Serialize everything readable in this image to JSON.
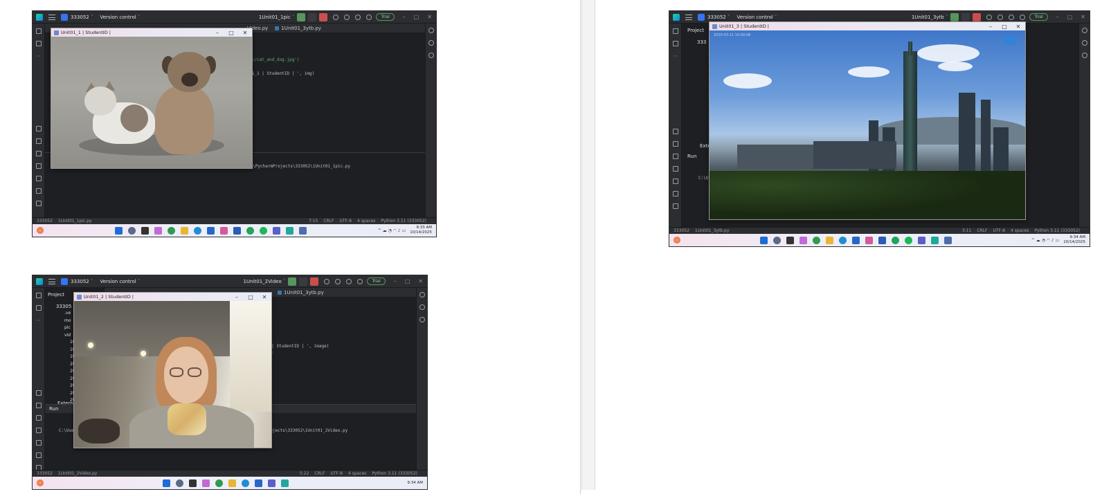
{
  "colors": {
    "accent_green": "#57965c",
    "accent_red": "#c94f4f",
    "ide_bg": "#1e1f22",
    "ide_panel": "#2b2d30"
  },
  "shot1": {
    "project": "333052",
    "version_control": "Version control",
    "run_config": "1Unit01_1pic",
    "trial": "Trial",
    "tabs": [
      "Video.py",
      "1Unit01_3ytb.py"
    ],
    "code_lines": [
      "'pic/cat_and_dog.jpg')",
      "()",
      "it01_1 | StudentID | ', img)"
    ],
    "run_cmd": "C:\\Users\\hanna\\PycharmProjects\\333052\\.venv\\Scripts\\python.exe C:\\Users\\hanna\\PycharmProjects\\333052\\1Unit01_1pic.py",
    "status_path": [
      "333052",
      "1Unit01_1pic.py"
    ],
    "status_right": [
      "7:15",
      "CRLF",
      "UTF-8",
      "4 spaces",
      "Python 3.11 (333052)"
    ],
    "popup_title": "Unit01_1 | StudentID |",
    "time": "9:33 AM",
    "date": "10/14/2025"
  },
  "shot2": {
    "project": "333052",
    "version_control": "Version control",
    "run_config": "1Unit01_3ytb",
    "trial": "Trial",
    "project_label": "Project",
    "tree_root": "333",
    "tree_external": "Exte",
    "run_label": "Run",
    "run_cmd": "C:\\U",
    "status_path": [
      "333052",
      "1Unit01_3ytb.py"
    ],
    "status_right": [
      "3:11",
      "CRLF",
      "UTF-8",
      "4 spaces",
      "Python 3.11 (333052)"
    ],
    "popup_title": "Unit01_3 | StudentID |",
    "photo_tag": "2020-03-11 10:09:08",
    "time": "9:34 AM",
    "date": "10/14/2025"
  },
  "shot3": {
    "project": "333052",
    "version_control": "Version control",
    "run_config": "1Unit01_2Video",
    "trial": "Trial",
    "project_label": "Project",
    "tabs": [
      "1Unit01_3ytb.py"
    ],
    "tree_root": "33305",
    "tree_items": [
      ".ve",
      "mo",
      "pic",
      "vid",
      "1Un",
      "1Un",
      "1Un",
      "2Un",
      "2Un",
      "2Un",
      "2Un",
      "2Un",
      "2Un"
    ],
    "tree_external": "Extern",
    "code_lines": [
      "2 | StudentID | ', image)",
      "27:"
    ],
    "run_label": "Run",
    "run_cmd_left": "C:\\Use",
    "run_cmd_right": "Projects\\333052\\1Unit01_2Video.py",
    "status_path": [
      "333052",
      "1Unit01_2Video.py"
    ],
    "status_right": [
      "5:22",
      "CRLF",
      "UTF-8",
      "4 spaces",
      "Python 3.11 (333052)"
    ],
    "popup_title": "Unit01_2 | StudentID |",
    "time": "9:34 AM"
  }
}
